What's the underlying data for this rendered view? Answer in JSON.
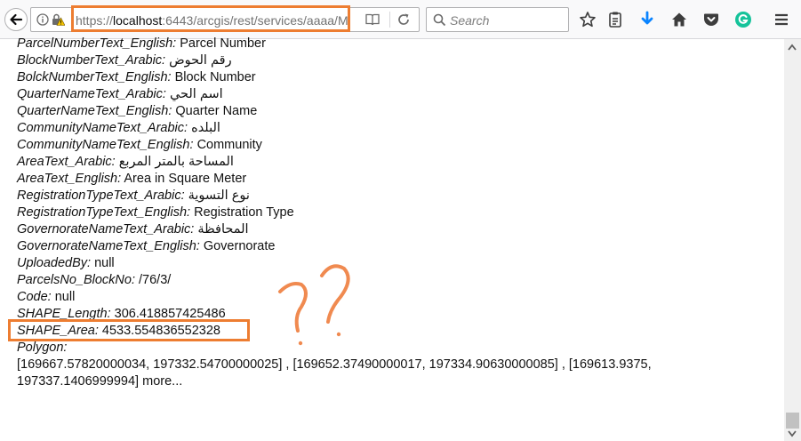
{
  "browser": {
    "url_prefix": "https://",
    "url_host": "localhost",
    "url_rest": ":6443/arcgis/rest/services/aaaa/M",
    "search_placeholder": "Search"
  },
  "colors": {
    "highlight": "#ed7d31",
    "download_arrow": "#0a84ff",
    "grammarly": "#15c39a"
  },
  "attributes": [
    {
      "key": "ParcelNumberText_English:",
      "value": "Parcel Number"
    },
    {
      "key": "BlockNumberText_Arabic:",
      "value": "رقم الحوض"
    },
    {
      "key": "BolckNumberText_English:",
      "value": "Block Number"
    },
    {
      "key": "QuarterNameText_Arabic:",
      "value": "اسم الحي"
    },
    {
      "key": "QuarterNameText_English:",
      "value": "Quarter Name"
    },
    {
      "key": "CommunityNameText_Arabic:",
      "value": "البلده"
    },
    {
      "key": "CommunityNameText_English:",
      "value": "Community"
    },
    {
      "key": "AreaText_Arabic:",
      "value": "المساحة بالمتر المربع"
    },
    {
      "key": "AreaText_English:",
      "value": "Area in Square Meter"
    },
    {
      "key": "RegistrationTypeText_Arabic:",
      "value": "نوع التسوية"
    },
    {
      "key": "RegistrationTypeText_English:",
      "value": "Registration Type"
    },
    {
      "key": "GovernorateNameText_Arabic:",
      "value": "المحافظة"
    },
    {
      "key": "GovernorateNameText_English:",
      "value": "Governorate"
    },
    {
      "key": "UploadedBy:",
      "value": "null"
    },
    {
      "key": "ParcelsNo_BlockNo:",
      "value": "/76/3/"
    },
    {
      "key": "Code:",
      "value": "null"
    },
    {
      "key": "SHAPE_Length:",
      "value": "306.418857425486"
    },
    {
      "key": "SHAPE_Area:",
      "value": "4533.554836552328"
    },
    {
      "key": "Polygon:",
      "value": ""
    }
  ],
  "polygon": {
    "values": "[169667.57820000034, 197332.54700000025] , [169652.37490000017, 197334.90630000085] , [169613.9375, 197337.1406999994]",
    "more_label": "more..."
  }
}
